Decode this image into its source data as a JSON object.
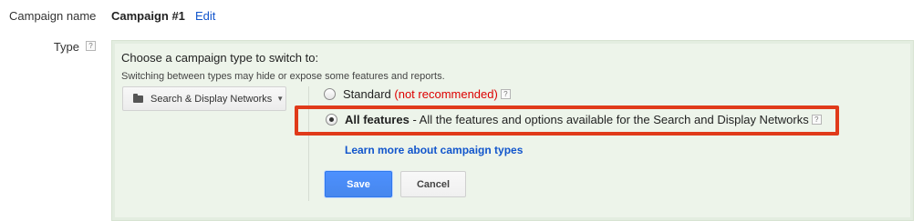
{
  "campaign": {
    "name_label": "Campaign name",
    "name_value": "Campaign #1",
    "edit_label": "Edit"
  },
  "type": {
    "label": "Type",
    "help_glyph": "?"
  },
  "panel": {
    "title": "Choose a campaign type to switch to:",
    "subtitle": "Switching between types may hide or expose some features and reports.",
    "network_dropdown": {
      "value": "Search & Display Networks",
      "icon": "folder-icon",
      "caret": "▼"
    },
    "options": {
      "standard": {
        "label": "Standard",
        "note": "(not recommended)",
        "selected": false
      },
      "all_features": {
        "label": "All features",
        "description": "- All the features and options available for the Search and Display Networks",
        "selected": true
      }
    },
    "learn_more": "Learn more about campaign types",
    "save_label": "Save",
    "cancel_label": "Cancel"
  },
  "colors": {
    "panel_bg": "#edf4ea",
    "link": "#1155cc",
    "highlight": "#e03a1a",
    "warning_text": "#dd0000",
    "primary_button": "#4d90fe"
  }
}
